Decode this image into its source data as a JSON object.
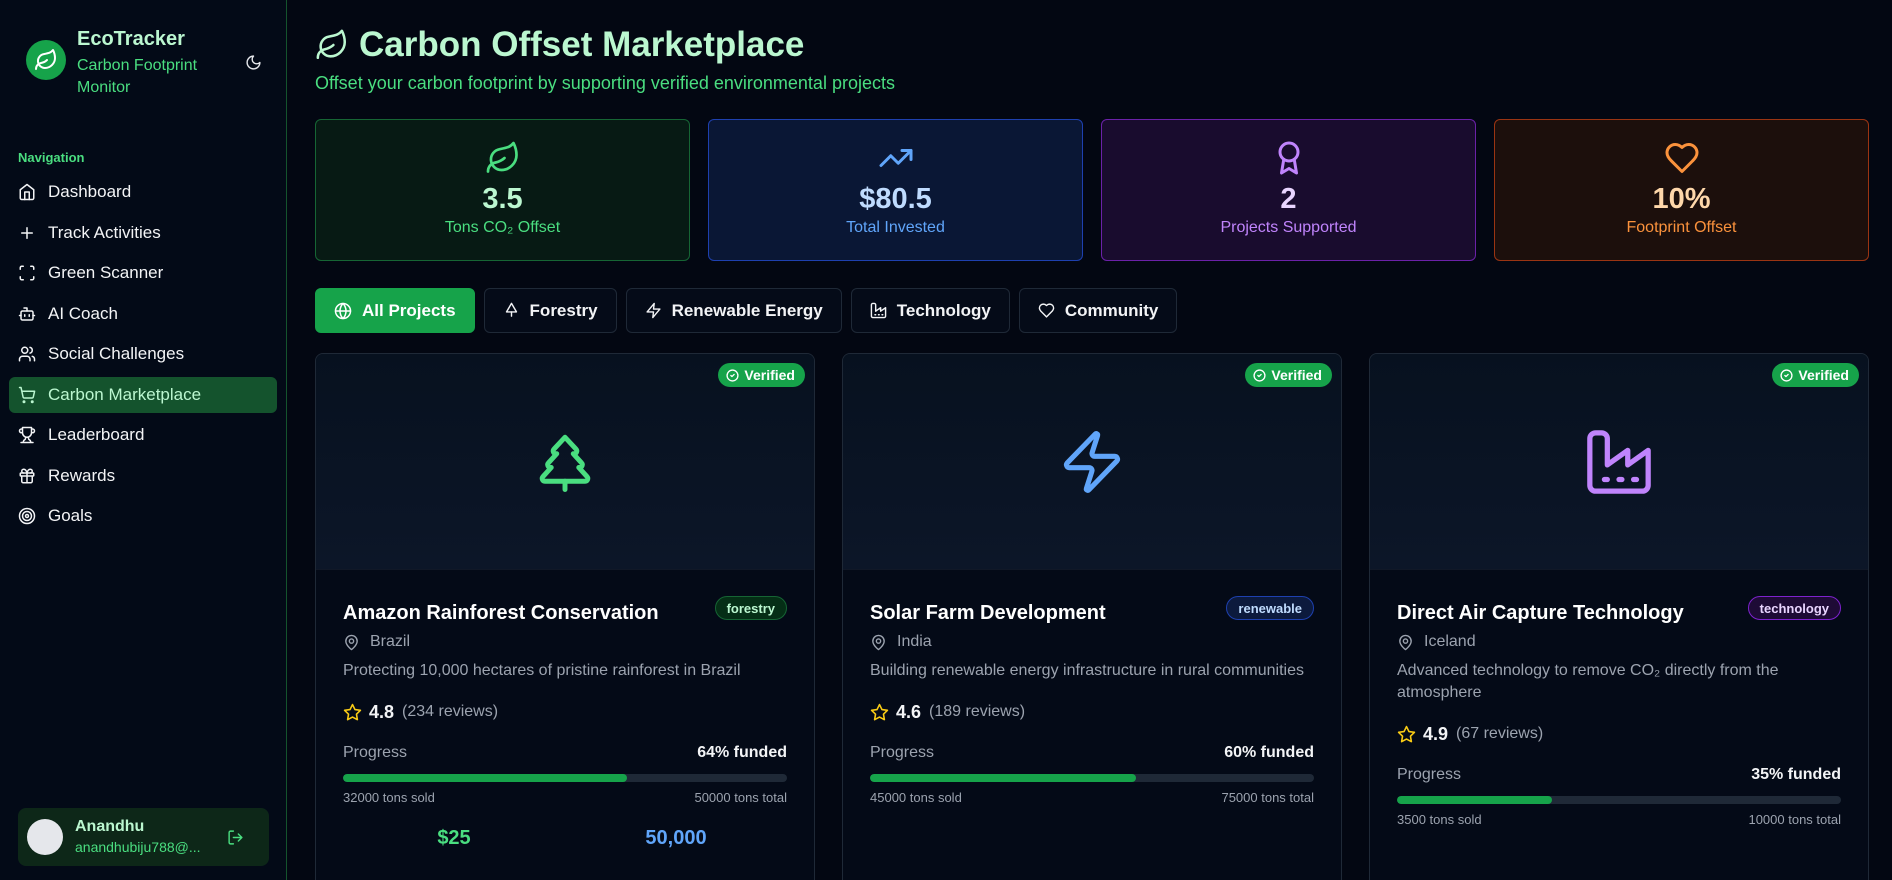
{
  "brand": {
    "title": "EcoTracker",
    "subtitle": "Carbon Footprint Monitor"
  },
  "nav": {
    "label": "Navigation",
    "items": [
      {
        "label": "Dashboard",
        "icon": "home-icon"
      },
      {
        "label": "Track Activities",
        "icon": "plus-icon"
      },
      {
        "label": "Green Scanner",
        "icon": "scan-icon"
      },
      {
        "label": "AI Coach",
        "icon": "bot-icon"
      },
      {
        "label": "Social Challenges",
        "icon": "users-icon"
      },
      {
        "label": "Carbon Marketplace",
        "icon": "cart-icon",
        "active": true
      },
      {
        "label": "Leaderboard",
        "icon": "trophy-icon"
      },
      {
        "label": "Rewards",
        "icon": "gift-icon"
      },
      {
        "label": "Goals",
        "icon": "target-icon"
      }
    ]
  },
  "user": {
    "name": "Anandhu",
    "email": "anandhubiju788@..."
  },
  "page": {
    "title": "Carbon Offset Marketplace",
    "subtitle": "Offset your carbon footprint by supporting verified environmental projects"
  },
  "stats": [
    {
      "value": "3.5",
      "label": "Tons CO₂ Offset",
      "icon": "leaf-icon",
      "color": "#4ade80"
    },
    {
      "value": "$80.5",
      "label": "Total Invested",
      "icon": "trending-up-icon",
      "color": "#60a5fa"
    },
    {
      "value": "2",
      "label": "Projects Supported",
      "icon": "award-icon",
      "color": "#c084fc"
    },
    {
      "value": "10%",
      "label": "Footprint Offset",
      "icon": "heart-icon",
      "color": "#fb923c"
    }
  ],
  "filters": [
    {
      "label": "All Projects",
      "icon": "globe-icon",
      "active": true
    },
    {
      "label": "Forestry",
      "icon": "tree-icon"
    },
    {
      "label": "Renewable Energy",
      "icon": "zap-icon"
    },
    {
      "label": "Technology",
      "icon": "factory-icon"
    },
    {
      "label": "Community",
      "icon": "heart-icon"
    }
  ],
  "projects": [
    {
      "verified": "Verified",
      "title": "Amazon Rainforest Conservation",
      "badge": "forestry",
      "location": "Brazil",
      "description": "Protecting 10,000 hectares of pristine rainforest in Brazil",
      "rating": "4.8",
      "reviews": "(234 reviews)",
      "progress_label": "Progress",
      "funded": "64% funded",
      "funded_fraction": 0.64,
      "sold": "32000 tons sold",
      "total": "50000 tons total",
      "price": "$25",
      "available": "50,000",
      "icon": "tree-icon",
      "icon_color": "#4ade80"
    },
    {
      "verified": "Verified",
      "title": "Solar Farm Development",
      "badge": "renewable",
      "location": "India",
      "description": "Building renewable energy infrastructure in rural communities",
      "rating": "4.6",
      "reviews": "(189 reviews)",
      "progress_label": "Progress",
      "funded": "60% funded",
      "funded_fraction": 0.6,
      "sold": "45000 tons sold",
      "total": "75000 tons total",
      "icon": "zap-icon",
      "icon_color": "#60a5fa"
    },
    {
      "verified": "Verified",
      "title": "Direct Air Capture Technology",
      "badge": "technology",
      "location": "Iceland",
      "description": "Advanced technology to remove CO₂ directly from the atmosphere",
      "rating": "4.9",
      "reviews": "(67 reviews)",
      "progress_label": "Progress",
      "funded": "35% funded",
      "funded_fraction": 0.35,
      "sold": "3500 tons sold",
      "total": "10000 tons total",
      "icon": "factory-icon",
      "icon_color": "#c084fc"
    }
  ]
}
